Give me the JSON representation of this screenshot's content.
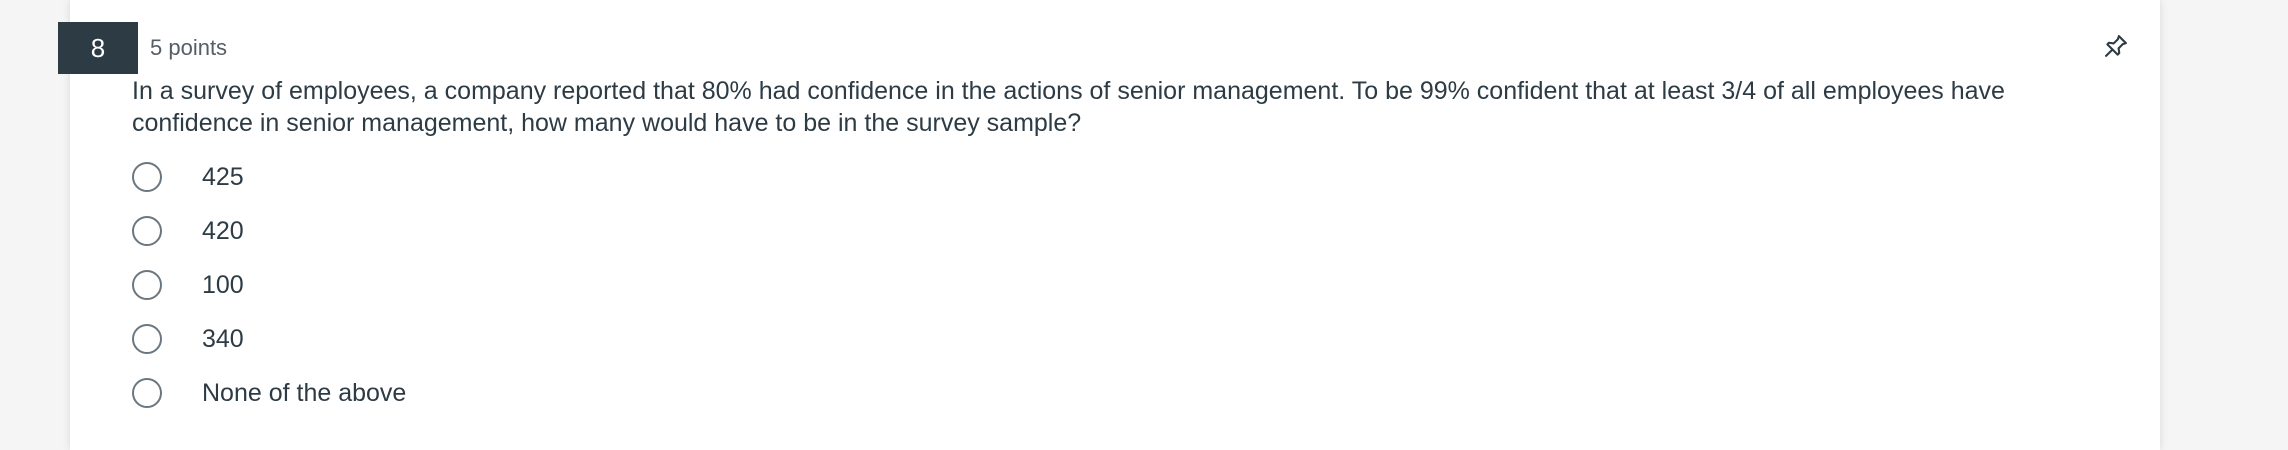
{
  "question": {
    "number": "8",
    "points": "5 points",
    "text": "In a survey of employees, a company reported that 80% had confidence in the actions of senior management. To be 99% confident that at least 3/4 of all employees have confidence in senior management, how many would have to be in the survey sample?",
    "pin_icon": "pin-icon"
  },
  "answers": [
    {
      "label": "425"
    },
    {
      "label": "420"
    },
    {
      "label": "100"
    },
    {
      "label": "340"
    },
    {
      "label": "None of the above"
    }
  ],
  "colors": {
    "header_bg": "#2d3b45",
    "text": "#2d3b45",
    "muted": "#555e66",
    "radio_border": "#6b7780"
  }
}
